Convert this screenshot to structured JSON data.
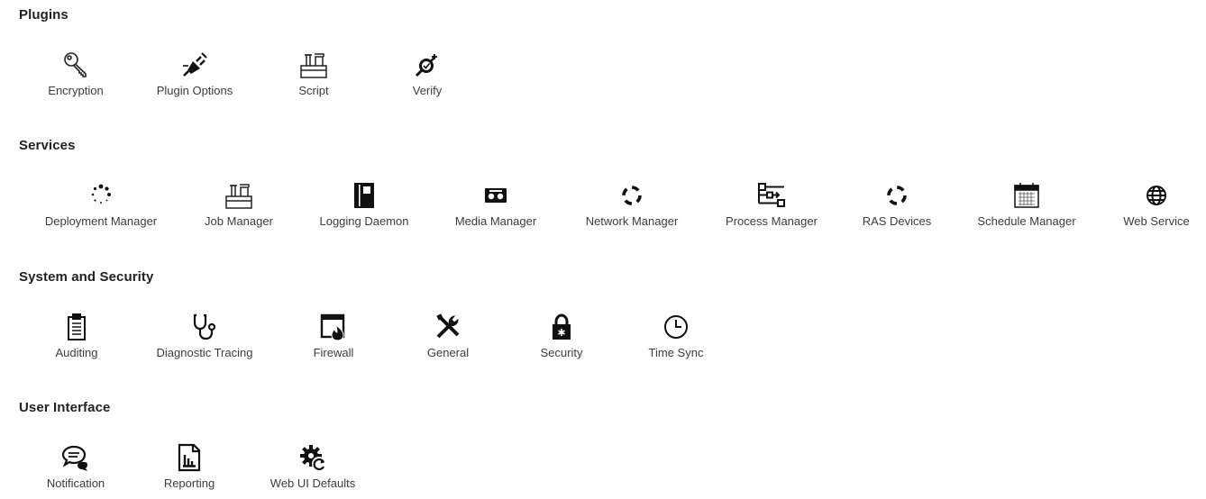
{
  "sections": [
    {
      "title": "Plugins",
      "items": [
        {
          "label": "Encryption",
          "icon": "key-icon"
        },
        {
          "label": "Plugin Options",
          "icon": "plug-icon"
        },
        {
          "label": "Script",
          "icon": "toolbox-icon"
        },
        {
          "label": "Verify",
          "icon": "verify-plug-icon"
        }
      ]
    },
    {
      "title": "Services",
      "items": [
        {
          "label": "Deployment Manager",
          "icon": "spinner-icon"
        },
        {
          "label": "Job Manager",
          "icon": "toolbox-icon"
        },
        {
          "label": "Logging Daemon",
          "icon": "book-icon"
        },
        {
          "label": "Media Manager",
          "icon": "cassette-icon"
        },
        {
          "label": "Network Manager",
          "icon": "ring-icon"
        },
        {
          "label": "Process Manager",
          "icon": "process-icon"
        },
        {
          "label": "RAS Devices",
          "icon": "ring-icon"
        },
        {
          "label": "Schedule Manager",
          "icon": "calendar-icon"
        },
        {
          "label": "Web Service",
          "icon": "globe-icon"
        }
      ]
    },
    {
      "title": "System and Security",
      "items": [
        {
          "label": "Auditing",
          "icon": "clipboard-icon"
        },
        {
          "label": "Diagnostic Tracing",
          "icon": "stethoscope-icon"
        },
        {
          "label": "Firewall",
          "icon": "firewall-icon"
        },
        {
          "label": "General",
          "icon": "tools-icon"
        },
        {
          "label": "Security",
          "icon": "lock-icon"
        },
        {
          "label": "Time Sync",
          "icon": "clock-icon"
        }
      ]
    },
    {
      "title": "User Interface",
      "items": [
        {
          "label": "Notification",
          "icon": "chat-icon"
        },
        {
          "label": "Reporting",
          "icon": "report-icon"
        },
        {
          "label": "Web UI Defaults",
          "icon": "gear-icon"
        }
      ]
    }
  ]
}
